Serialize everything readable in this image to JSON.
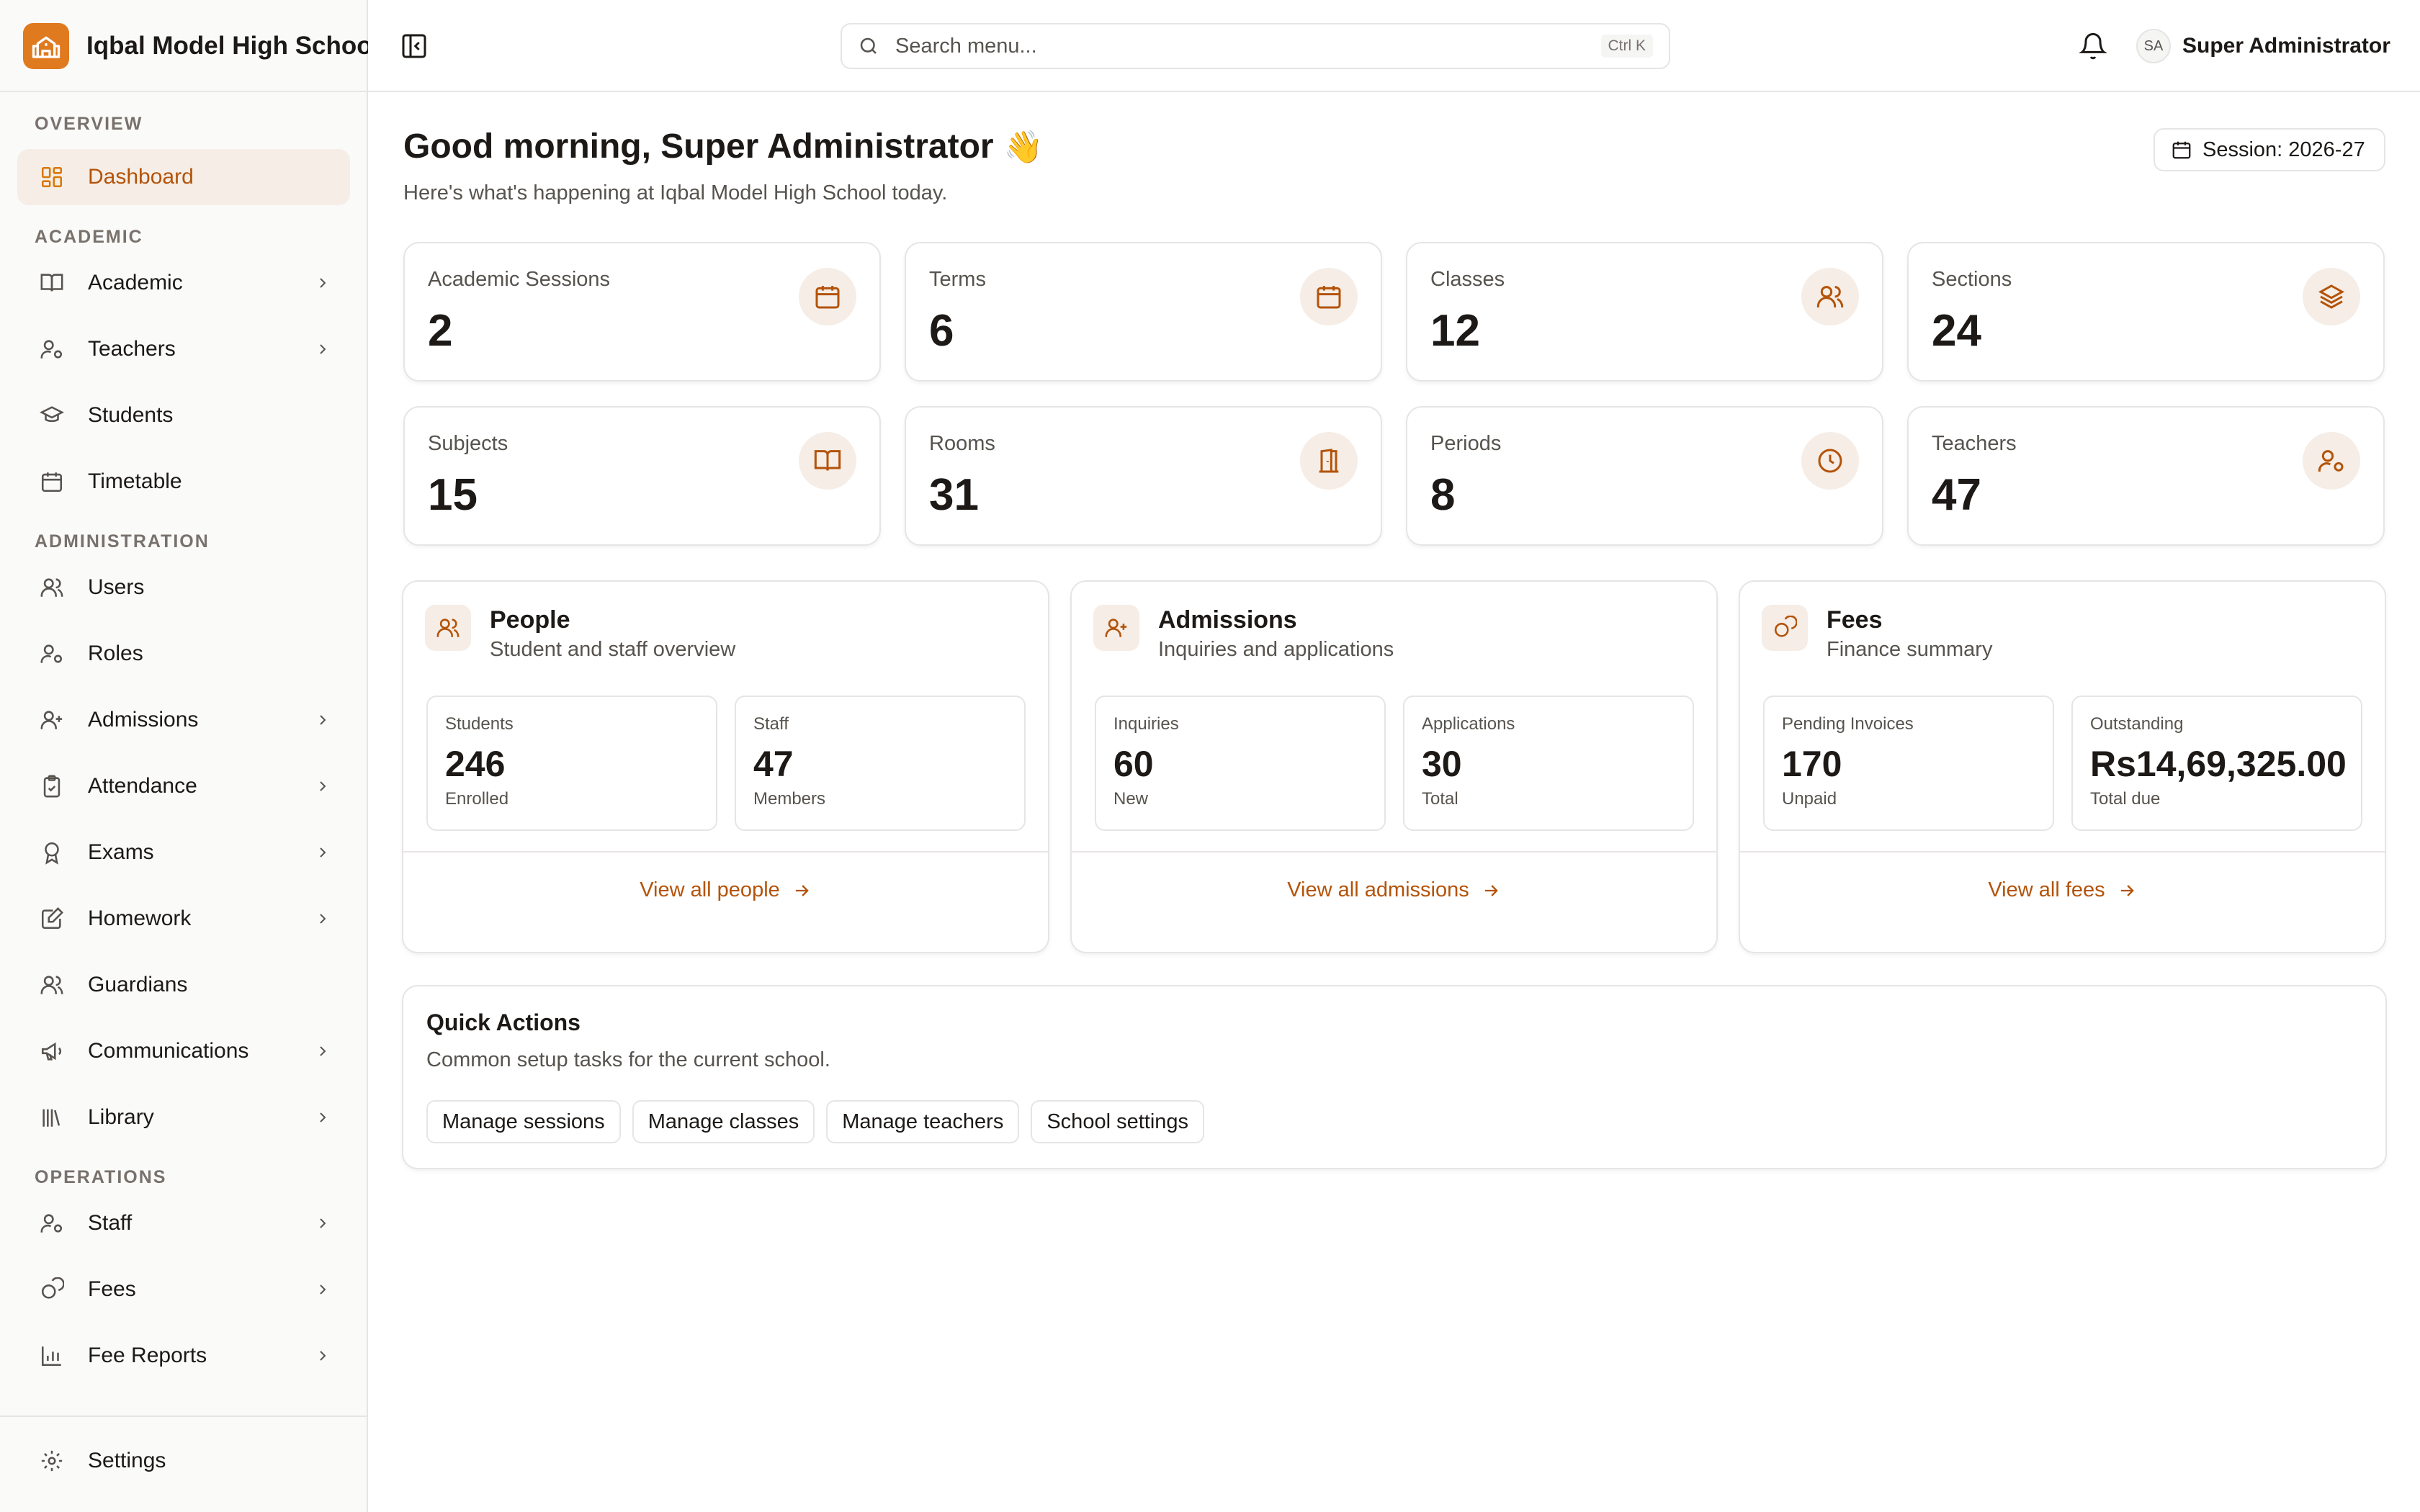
{
  "brand": {
    "name": "Iqbal Model High School"
  },
  "sidebar": {
    "groups": [
      {
        "label": "Overview",
        "items": [
          {
            "label": "Dashboard",
            "icon": "dashboard-icon",
            "active": true
          }
        ]
      },
      {
        "label": "Academic",
        "items": [
          {
            "label": "Academic",
            "icon": "book-icon",
            "expandable": true
          },
          {
            "label": "Teachers",
            "icon": "user-cog-icon",
            "expandable": true
          },
          {
            "label": "Students",
            "icon": "graduation-cap-icon",
            "expandable": false
          },
          {
            "label": "Timetable",
            "icon": "calendar-icon",
            "expandable": false
          }
        ]
      },
      {
        "label": "Administration",
        "items": [
          {
            "label": "Users",
            "icon": "users-icon",
            "expandable": false
          },
          {
            "label": "Roles",
            "icon": "user-cog-icon",
            "expandable": false
          },
          {
            "label": "Admissions",
            "icon": "user-plus-icon",
            "expandable": true
          },
          {
            "label": "Attendance",
            "icon": "clipboard-check-icon",
            "expandable": true
          },
          {
            "label": "Exams",
            "icon": "award-icon",
            "expandable": true
          },
          {
            "label": "Homework",
            "icon": "edit-icon",
            "expandable": true
          },
          {
            "label": "Guardians",
            "icon": "users-icon",
            "expandable": false
          },
          {
            "label": "Communications",
            "icon": "megaphone-icon",
            "expandable": true
          },
          {
            "label": "Library",
            "icon": "library-icon",
            "expandable": true
          }
        ]
      },
      {
        "label": "Operations",
        "items": [
          {
            "label": "Staff",
            "icon": "user-cog-icon",
            "expandable": true
          },
          {
            "label": "Fees",
            "icon": "coins-icon",
            "expandable": true
          },
          {
            "label": "Fee Reports",
            "icon": "bar-chart-icon",
            "expandable": true
          }
        ]
      }
    ],
    "footer": {
      "label": "Settings",
      "icon": "gear-icon"
    }
  },
  "header": {
    "search_placeholder": "Search menu...",
    "search_shortcut": "Ctrl K",
    "user_initials": "SA",
    "user_name": "Super Administrator"
  },
  "main": {
    "greeting": "Good morning, Super Administrator",
    "greeting_emoji": "👋",
    "subtitle": "Here's what's happening at Iqbal Model High School today.",
    "session_label": "Session: 2026-27",
    "stats": [
      {
        "label": "Academic Sessions",
        "value": "2",
        "icon": "calendar-icon"
      },
      {
        "label": "Terms",
        "value": "6",
        "icon": "calendar-icon"
      },
      {
        "label": "Classes",
        "value": "12",
        "icon": "users-icon"
      },
      {
        "label": "Sections",
        "value": "24",
        "icon": "layers-icon"
      },
      {
        "label": "Subjects",
        "value": "15",
        "icon": "book-open-icon"
      },
      {
        "label": "Rooms",
        "value": "31",
        "icon": "door-icon"
      },
      {
        "label": "Periods",
        "value": "8",
        "icon": "clock-icon"
      },
      {
        "label": "Teachers",
        "value": "47",
        "icon": "user-cog-icon"
      }
    ],
    "panels": [
      {
        "title": "People",
        "subtitle": "Student and staff overview",
        "icon": "users-icon",
        "metrics": [
          {
            "label": "Students",
            "value": "246",
            "note": "Enrolled"
          },
          {
            "label": "Staff",
            "value": "47",
            "note": "Members"
          }
        ],
        "link": "View all people"
      },
      {
        "title": "Admissions",
        "subtitle": "Inquiries and applications",
        "icon": "user-plus-icon",
        "metrics": [
          {
            "label": "Inquiries",
            "value": "60",
            "note": "New"
          },
          {
            "label": "Applications",
            "value": "30",
            "note": "Total"
          }
        ],
        "link": "View all admissions"
      },
      {
        "title": "Fees",
        "subtitle": "Finance summary",
        "icon": "coins-icon",
        "metrics": [
          {
            "label": "Pending Invoices",
            "value": "170",
            "note": "Unpaid"
          },
          {
            "label": "Outstanding",
            "value": "Rs14,69,325.00",
            "note": "Total due"
          }
        ],
        "link": "View all fees"
      }
    ],
    "quick_actions": {
      "title": "Quick Actions",
      "subtitle": "Common setup tasks for the current school.",
      "buttons": [
        "Manage sessions",
        "Manage classes",
        "Manage teachers",
        "School settings"
      ]
    }
  },
  "colors": {
    "accent": "#e07a1f",
    "accent_text": "#b45309",
    "icon_bg": "#f5ede6",
    "border": "#e7e5e4"
  }
}
